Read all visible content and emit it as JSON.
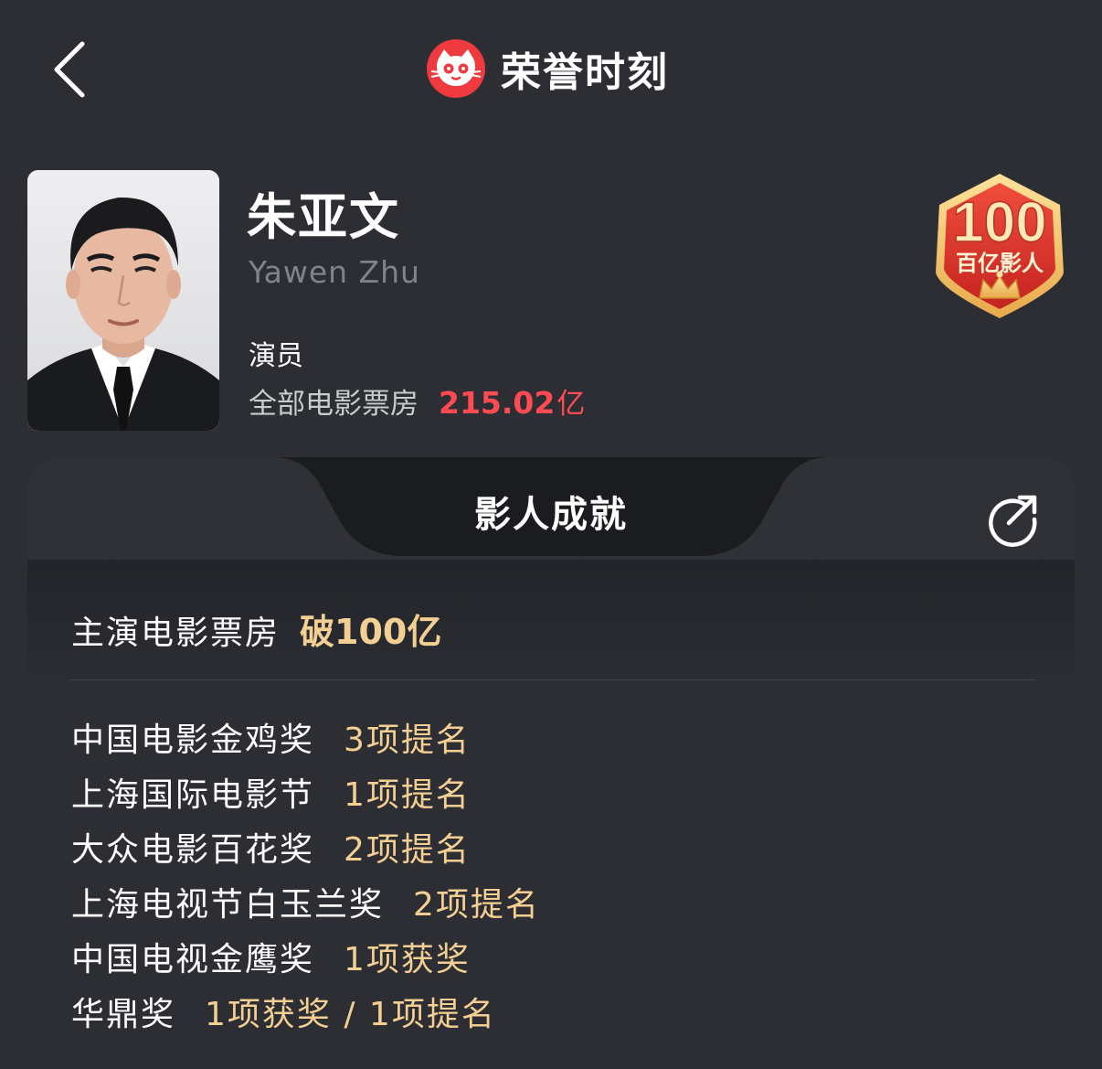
{
  "header": {
    "title": "荣誉时刻",
    "back_icon": "chevron-left-icon",
    "logo_icon": "cat-logo-icon"
  },
  "profile": {
    "name_cn": "朱亚文",
    "name_en": "Yawen Zhu",
    "role": "演员",
    "boxoffice_label": "全部电影票房",
    "boxoffice_value": "215.02",
    "boxoffice_unit": "亿",
    "badge": {
      "number": "100",
      "text": "百亿影人"
    }
  },
  "achievements": {
    "title": "影人成就",
    "share_icon": "share-icon",
    "highlight": {
      "label": "主演电影票房",
      "value": "破100亿"
    },
    "awards": [
      {
        "name": "中国电影金鸡奖",
        "result": "3项提名"
      },
      {
        "name": "上海国际电影节",
        "result": "1项提名"
      },
      {
        "name": "大众电影百花奖",
        "result": "2项提名"
      },
      {
        "name": "上海电视节白玉兰奖",
        "result": "2项提名"
      },
      {
        "name": "中国电视金鹰奖",
        "result": "1项获奖"
      },
      {
        "name": "华鼎奖",
        "result": "1项获奖 / 1项提名"
      }
    ]
  },
  "colors": {
    "background": "#2c2e34",
    "accent_red": "#ff4b51",
    "gold": "#f4cf93",
    "secondary_text": "#80838a"
  }
}
